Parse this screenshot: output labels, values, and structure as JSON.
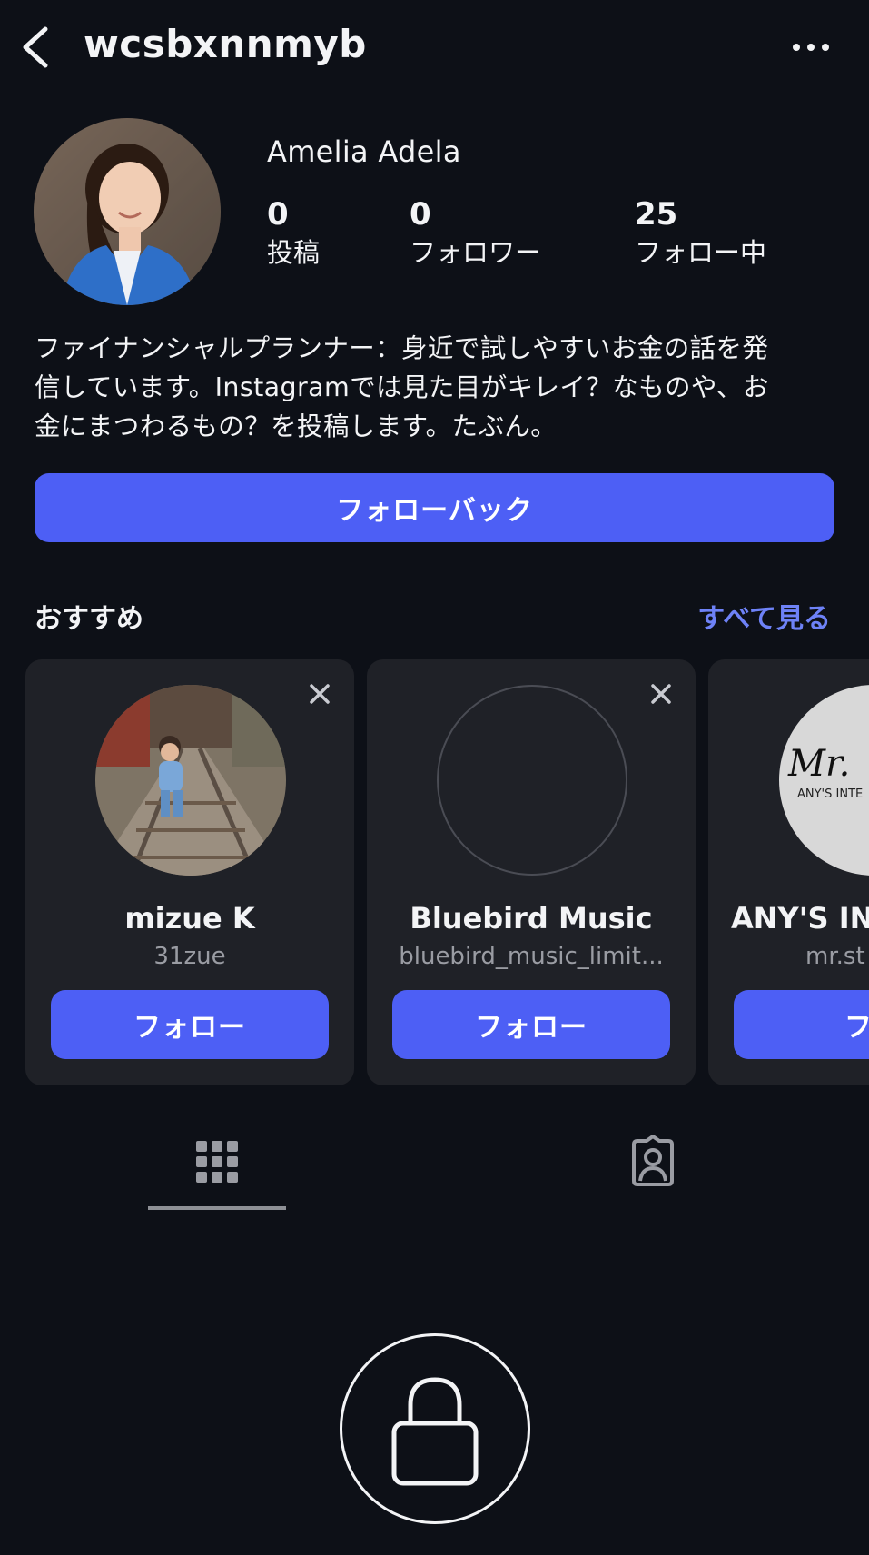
{
  "header": {
    "username": "wcsbxnnmyb",
    "back_icon": "chevron-left-icon",
    "more_icon": "more-horizontal-icon"
  },
  "profile": {
    "display_name": "Amelia Adela",
    "stats": {
      "posts": {
        "value": "0",
        "label": "投稿"
      },
      "followers": {
        "value": "0",
        "label": "フォロワー"
      },
      "following": {
        "value": "25",
        "label": "フォロー中"
      }
    },
    "bio_lines": [
      "ファイナンシャルプランナー：身近で試しやすいお金の話を発",
      "信しています。Instagramでは見た目がキレイ？なものや、お",
      "金にまつわるもの？を投稿します。たぶん。"
    ],
    "follow_back_label": "フォローバック"
  },
  "suggestions": {
    "title": "おすすめ",
    "see_all": "すべて見る",
    "cards": [
      {
        "name": "mizue K",
        "handle": "31zue",
        "follow_label": "フォロー"
      },
      {
        "name": "Bluebird Music",
        "handle": "bluebird_music_limit...",
        "follow_label": "フォロー"
      },
      {
        "name": "ANY'S INT",
        "handle": "mr.st",
        "follow_label": "フォ",
        "avatar_text": "Mr.",
        "avatar_subtext": "ANY'S INTE"
      }
    ]
  },
  "tabs": [
    {
      "name": "posts-grid",
      "icon": "grid-icon",
      "active": true
    },
    {
      "name": "tagged",
      "icon": "tagged-person-icon",
      "active": false
    }
  ],
  "private_account": {
    "icon": "lock-icon"
  },
  "colors": {
    "background": "#0d1017",
    "accent": "#4d5ff5",
    "link": "#6e82f7",
    "card": "#1f2127",
    "muted_text": "#9a9ca3"
  }
}
